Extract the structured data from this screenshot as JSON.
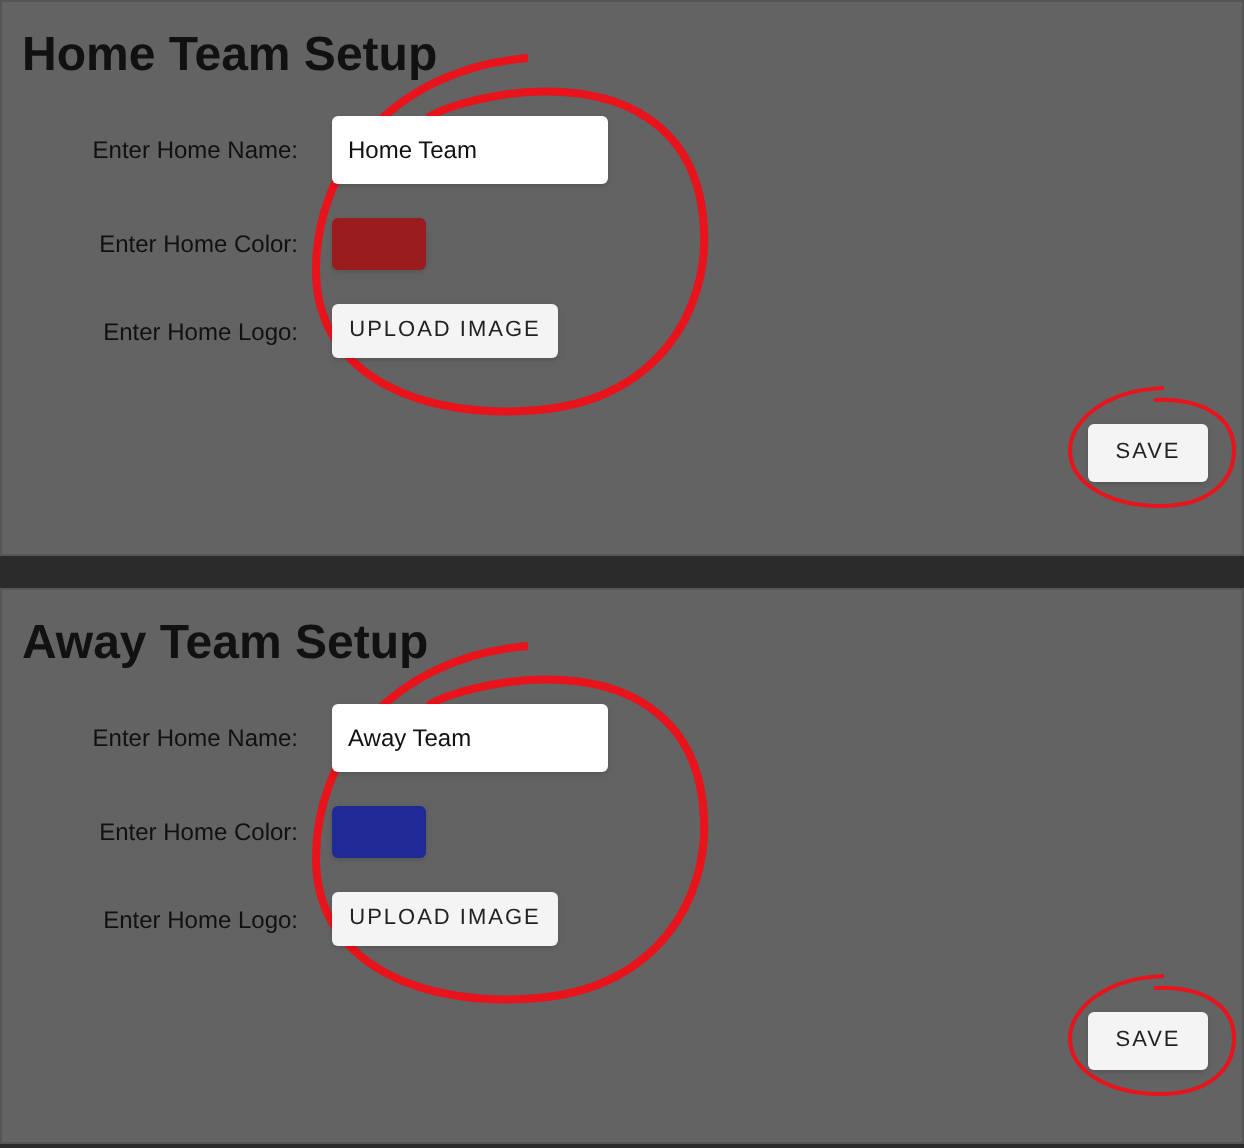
{
  "panels": [
    {
      "title": "Home Team Setup",
      "name_label": "Enter Home Name:",
      "name_value": "Home Team",
      "color_label": "Enter Home Color:",
      "color": "#9b1c1f",
      "logo_label": "Enter Home Logo:",
      "upload_button": "UPLOAD IMAGE",
      "save_button": "SAVE"
    },
    {
      "title": "Away Team Setup",
      "name_label": "Enter Home Name:",
      "name_value": "Away Team",
      "color_label": "Enter Home Color:",
      "color": "#1f2a96",
      "logo_label": "Enter Home Logo:",
      "upload_button": "UPLOAD IMAGE",
      "save_button": "SAVE"
    }
  ]
}
